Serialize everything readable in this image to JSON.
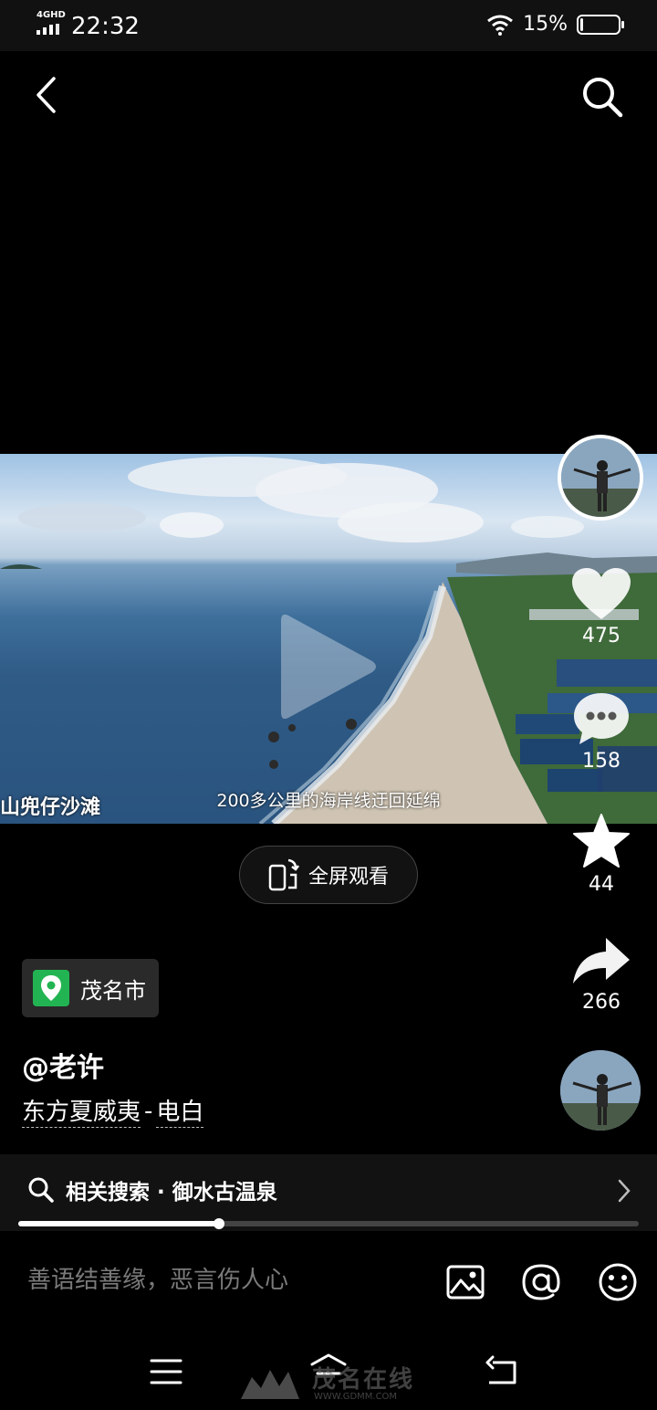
{
  "status_bar": {
    "network": "4GHD",
    "time": "22:32",
    "battery_percent": "15%",
    "battery_level": 0.15
  },
  "top_nav": {
    "back_icon": "chevron-left-icon",
    "search_icon": "search-icon"
  },
  "video": {
    "caption_left": "山兜仔沙滩",
    "caption_center": "200多公里的海岸线迂回延绵",
    "play_icon": "play-icon"
  },
  "actions": {
    "like_count": "475",
    "comment_count": "158",
    "favorite_count": "44",
    "share_count": "266"
  },
  "fullscreen": {
    "label": "全屏观看",
    "icon": "rotate-phone-icon"
  },
  "location": {
    "label": "茂名市",
    "icon": "location-pin-icon"
  },
  "author": {
    "name": "@老许"
  },
  "music": {
    "artist": "东方夏威夷",
    "separator": "-",
    "title": "电白"
  },
  "related_search": {
    "label": "相关搜索 · 御水古温泉",
    "icon": "search-icon"
  },
  "progress": {
    "fraction": 0.324
  },
  "comment_bar": {
    "placeholder": "善语结善缘，恶言伤人心",
    "icons": [
      "image-icon",
      "at-icon",
      "emoji-icon"
    ]
  },
  "watermark": {
    "text": "茂名在线",
    "url": "WWW.GDMM.COM"
  },
  "colors": {
    "background": "#000000",
    "location_green": "#22b452",
    "panel": "#121212"
  }
}
